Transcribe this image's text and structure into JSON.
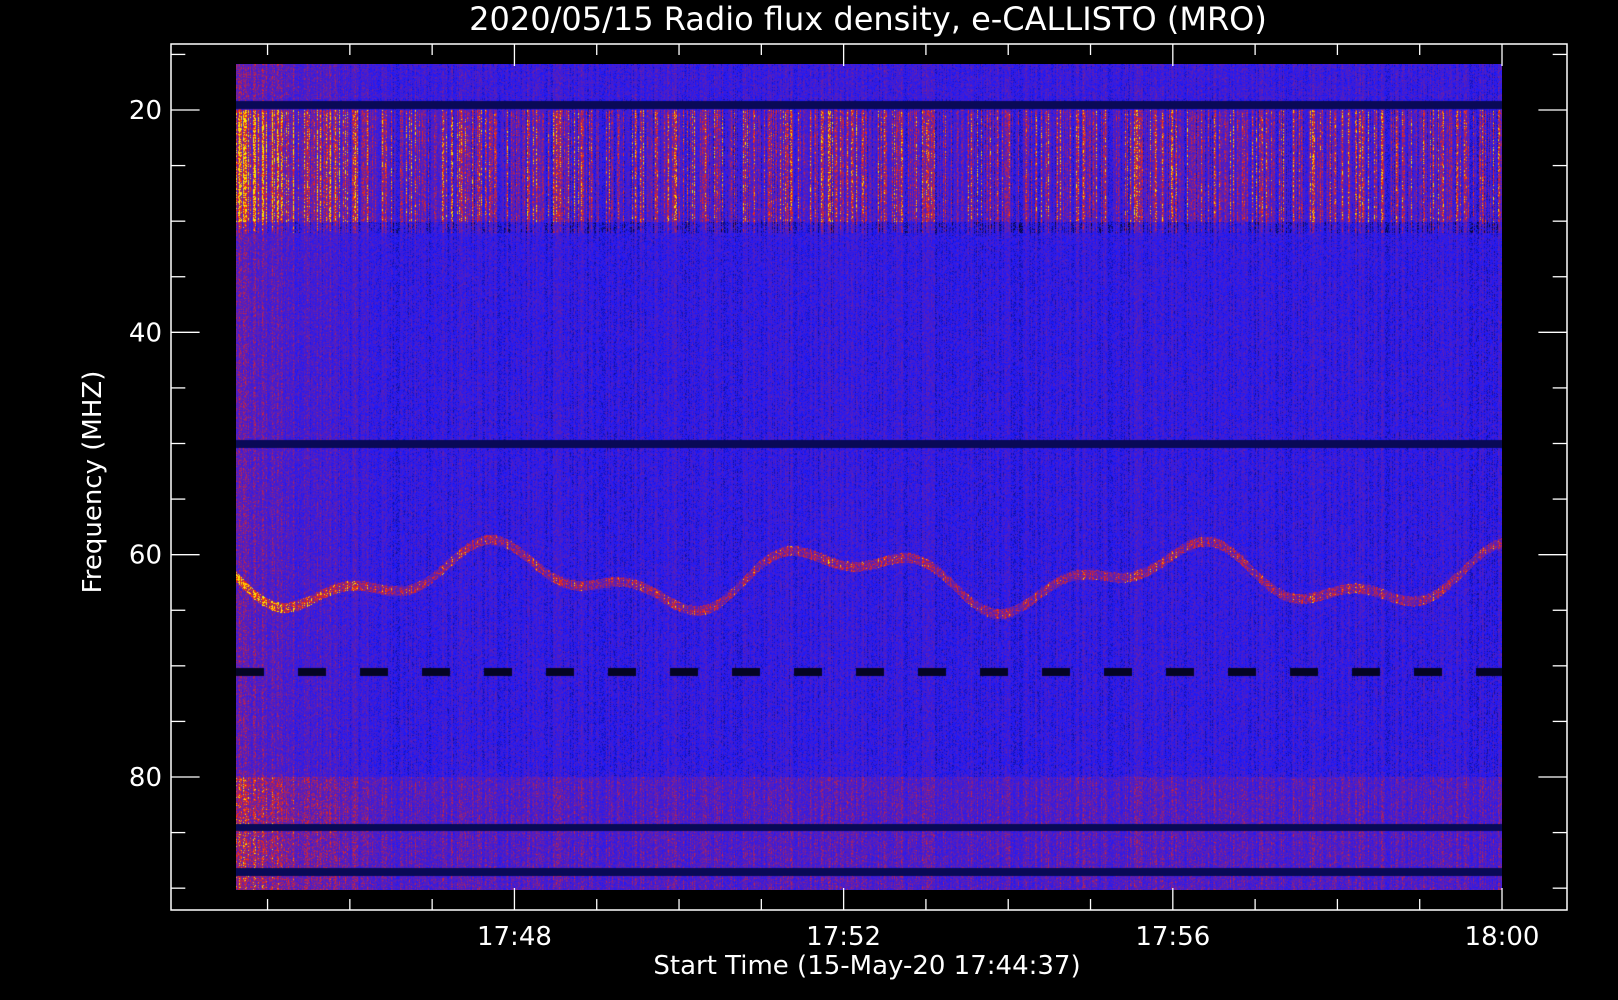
{
  "chart_data": {
    "type": "heatmap",
    "title": "2020/05/15  Radio flux density, e-CALLISTO (MRO)",
    "xlabel": "Start Time (15-May-20 17:44:37)",
    "ylabel": "Frequency (MHZ)",
    "x_start": "17:44:37",
    "x_end": "18:00:00",
    "x_ticks": [
      {
        "value": "17:48",
        "label": "17:48"
      },
      {
        "value": "17:52",
        "label": "17:52"
      },
      {
        "value": "17:56",
        "label": "17:56"
      },
      {
        "value": "18:00",
        "label": "18:00"
      }
    ],
    "x_minor_tick_interval_min": 1,
    "y_ticks": [
      {
        "value": 20,
        "label": "20"
      },
      {
        "value": 40,
        "label": "40"
      },
      {
        "value": 60,
        "label": "60"
      },
      {
        "value": 80,
        "label": "80"
      }
    ],
    "y_minor_tick_interval_mhz": 5,
    "ylim": [
      14,
      92
    ],
    "y_inverted": true,
    "freq_range_mhz": [
      16,
      90
    ],
    "colormap": {
      "low": "#000000",
      "mid": "#1a1aff",
      "high": "#ff2a00",
      "peak": "#ffe800"
    },
    "features": [
      {
        "type": "band_strong_rfi",
        "freq_range_mhz": [
          20,
          30
        ]
      },
      {
        "type": "band_continuum",
        "freq_range_mhz": [
          80,
          90
        ]
      },
      {
        "type": "line",
        "freq_mhz": 50
      },
      {
        "type": "line_dashed",
        "freq_mhz": 70.5
      },
      {
        "type": "line",
        "freq_mhz": 19.5
      },
      {
        "type": "line",
        "freq_mhz": 84.5
      },
      {
        "type": "line",
        "freq_mhz": 88.5
      }
    ]
  }
}
